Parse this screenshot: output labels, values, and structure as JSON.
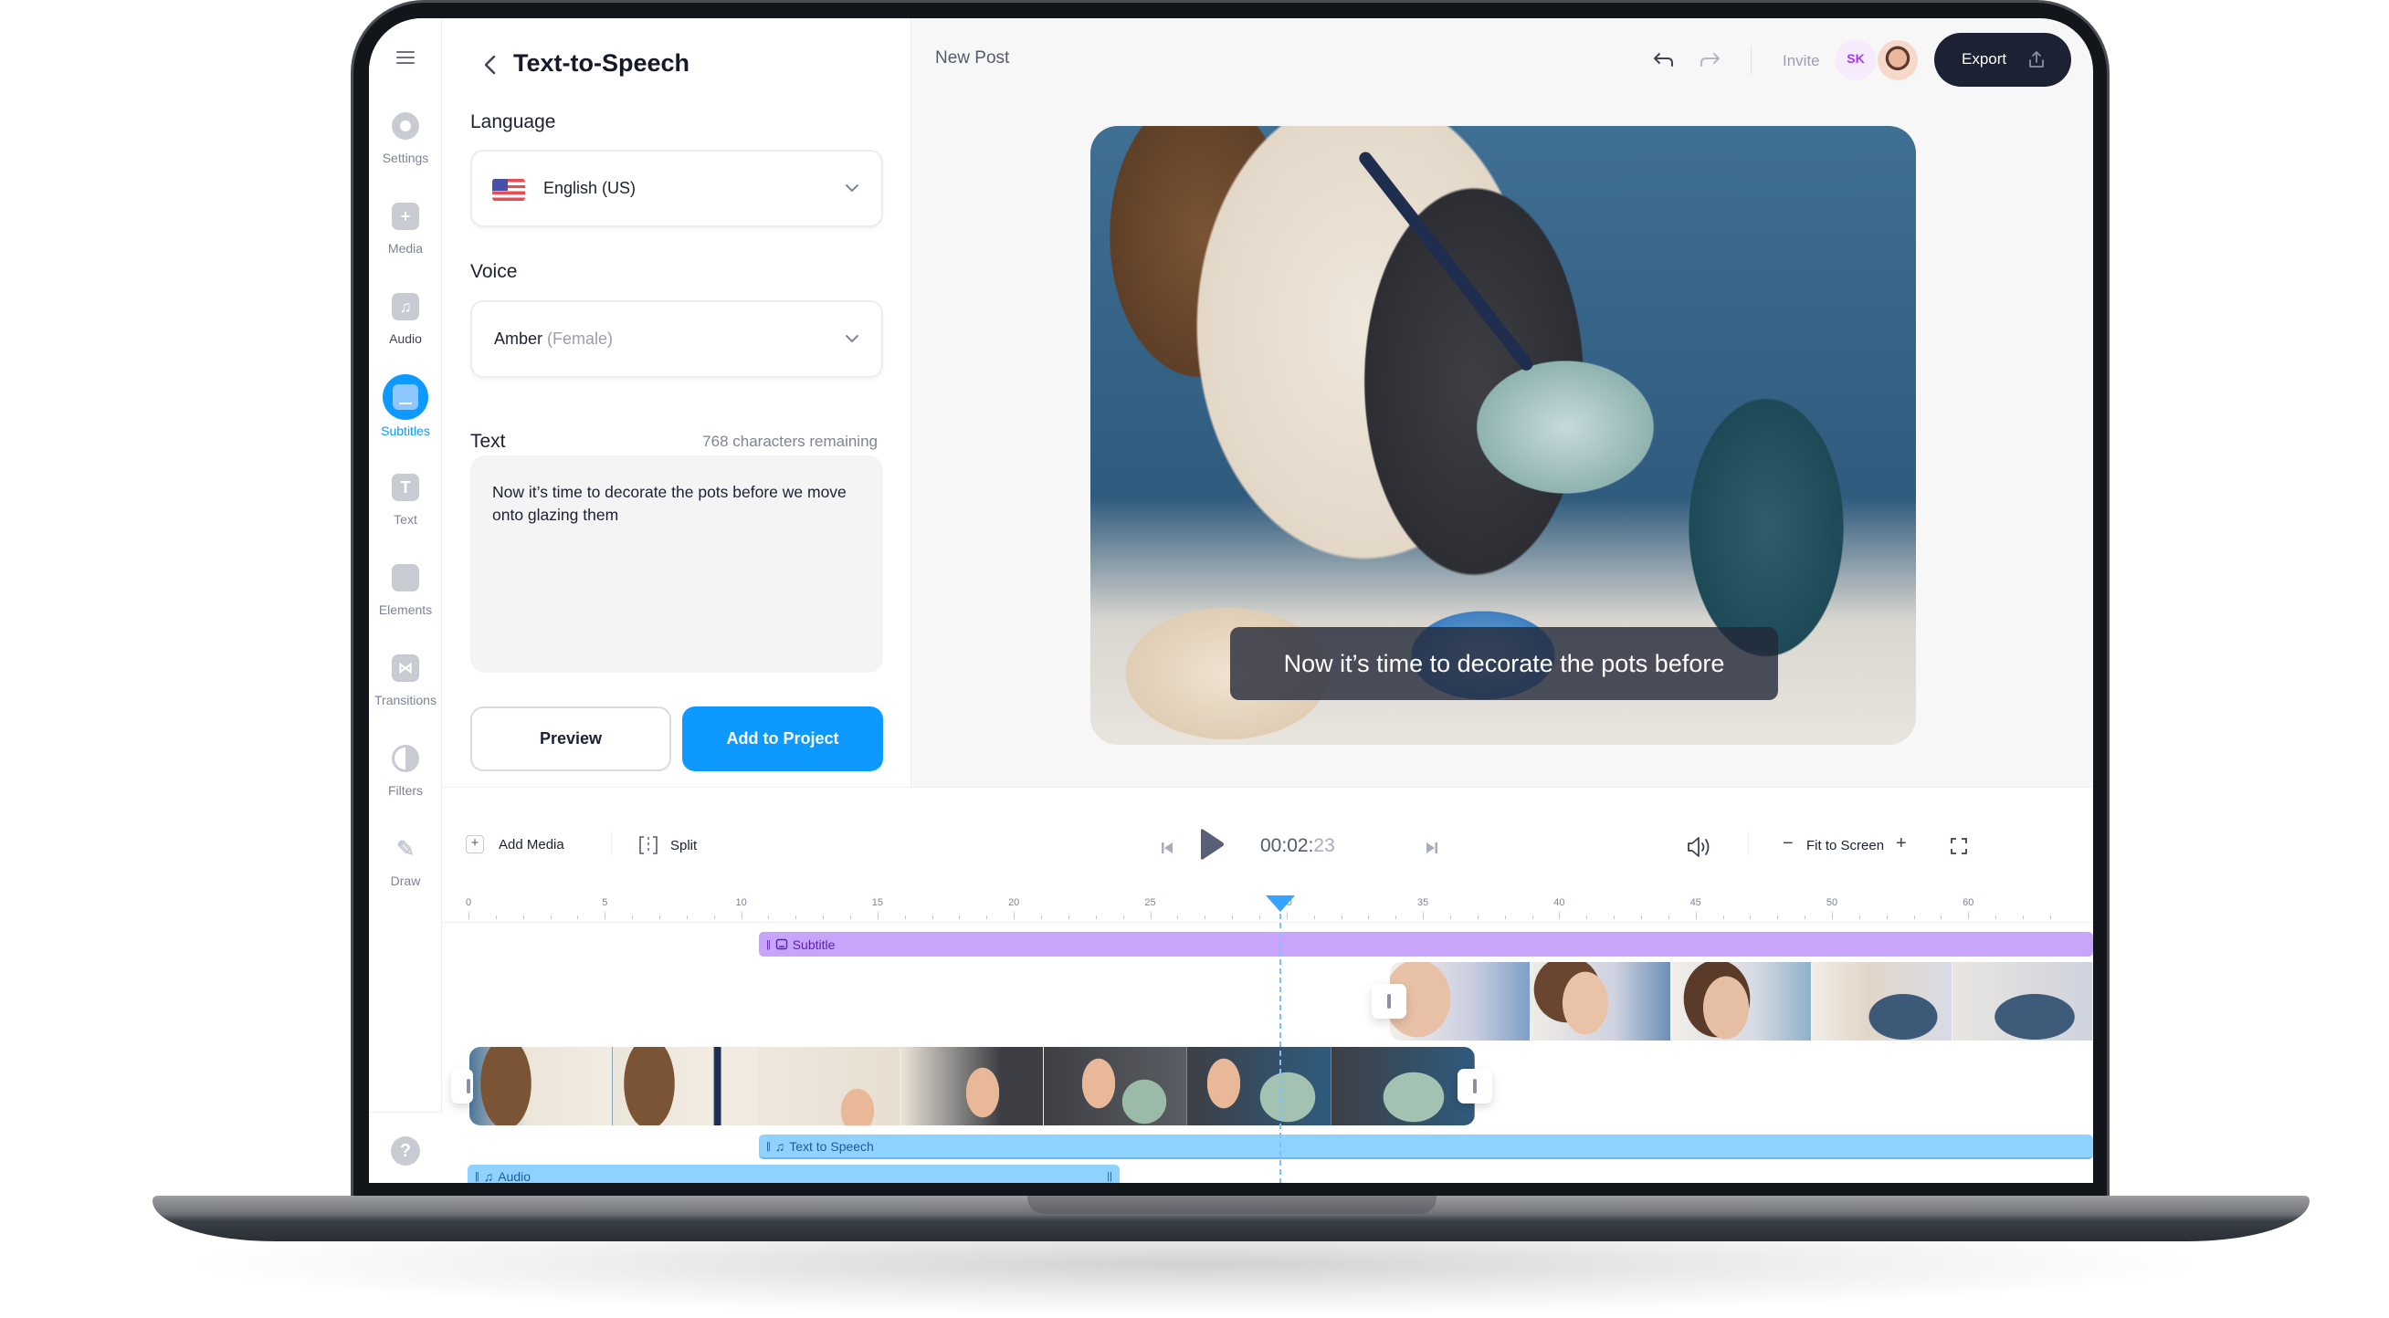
{
  "sidebar": {
    "menu_icon": "hamburger-icon",
    "items": [
      {
        "label": "Settings",
        "icon": "settings-icon",
        "active": false
      },
      {
        "label": "Media",
        "icon": "plus-square-icon",
        "active": false
      },
      {
        "label": "Audio",
        "icon": "music-note-icon",
        "active": false
      },
      {
        "label": "Subtitles",
        "icon": "subtitles-icon",
        "active": true
      },
      {
        "label": "Text",
        "icon": "text-icon",
        "active": false
      },
      {
        "label": "Elements",
        "icon": "sticker-icon",
        "active": false
      },
      {
        "label": "Transitions",
        "icon": "bowtie-icon",
        "active": false
      },
      {
        "label": "Filters",
        "icon": "half-circle-icon",
        "active": false
      },
      {
        "label": "Draw",
        "icon": "pencil-icon",
        "active": false
      }
    ],
    "help_label": "?"
  },
  "panel": {
    "title": "Text-to-Speech",
    "language_label": "Language",
    "language_value": "English (US)",
    "voice_label": "Voice",
    "voice_name": "Amber",
    "voice_gender": "(Female)",
    "text_label": "Text",
    "chars_remaining": "768 characters remaining",
    "text_value": "Now it’s time to decorate the pots before we move onto glazing them",
    "preview_label": "Preview",
    "add_label": "Add to Project"
  },
  "header": {
    "project_name": "New Post",
    "invite_label": "Invite",
    "collaborator_initials": "SK",
    "export_label": "Export"
  },
  "preview": {
    "subtitle_text": "Now it’s time to decorate the pots before"
  },
  "timeline": {
    "add_media_label": "Add Media",
    "split_label": "Split",
    "timecode_main": "00:02:",
    "timecode_frames": "23",
    "zoom_label": "Fit to Screen",
    "ruler_labels": [
      "0",
      "5",
      "10",
      "15",
      "20",
      "25",
      "30",
      "35",
      "40",
      "45",
      "50",
      "60"
    ],
    "playhead_position_units": 28.8,
    "tracks": {
      "subtitle_label": "Subtitle",
      "tts_label": "Text to Speech",
      "audio_label": "Audio"
    }
  },
  "colors": {
    "accent": "#0d99ff",
    "subtitle_track": "#c8a5fb",
    "audio_track": "#8ed3ff",
    "export_bg": "#1c2134"
  }
}
